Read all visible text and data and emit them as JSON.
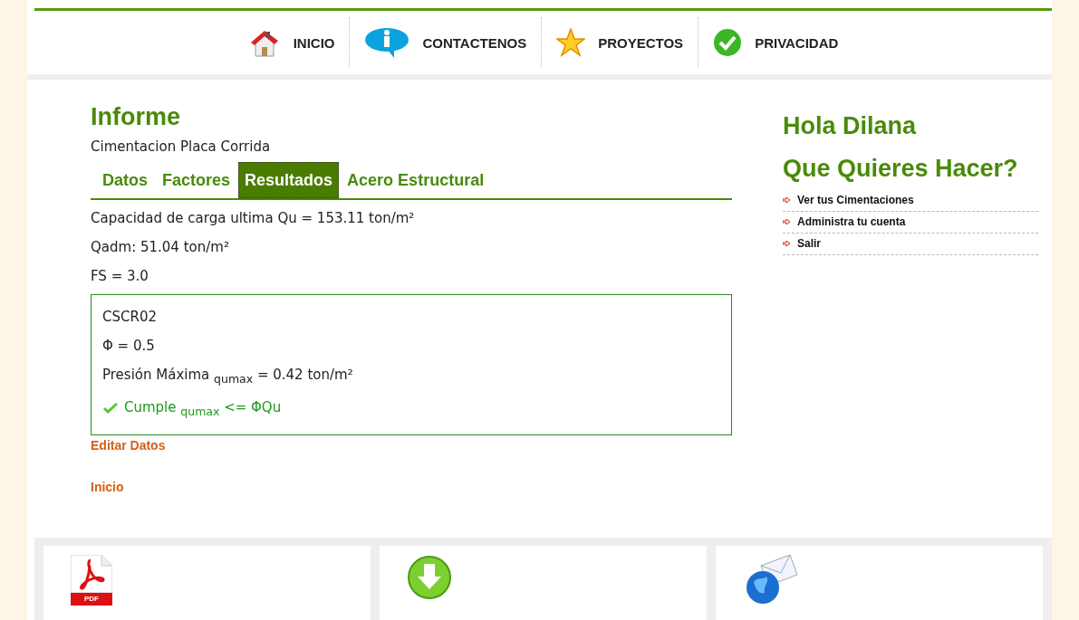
{
  "nav": [
    {
      "label": "INICIO",
      "kind": "house"
    },
    {
      "label": "CONTACTENOS",
      "kind": "info"
    },
    {
      "label": "PROYECTOS",
      "kind": "star"
    },
    {
      "label": "PRIVACIDAD",
      "kind": "check"
    }
  ],
  "report": {
    "title": "Informe",
    "subtitle": "Cimentacion Placa Corrida",
    "tabs": [
      {
        "label": "Datos",
        "selected": false
      },
      {
        "label": "Factores",
        "selected": false
      },
      {
        "label": "Resultados",
        "selected": true
      },
      {
        "label": "Acero Estructural",
        "selected": false
      }
    ],
    "results": [
      "Capacidad de carga ultima Qu = 153.11 ton/m²",
      "Qadm: 51.04 ton/m²",
      "FS = 3.0"
    ],
    "check_box": {
      "lines": [
        "CSCR02",
        "Φ = 0.5",
        "Presión Máxima $_{qumax}$ = 0.42 ton/m²"
      ],
      "verdict": {
        "text": "Cumple $_{qumax}$ <= ΦQu",
        "passed": true
      }
    },
    "links": [
      "Editar Datos",
      "Inicio"
    ]
  },
  "sidebar": {
    "greeting": "Hola Dilana",
    "heading": "Que Quieres Hacer?",
    "items": [
      "Ver tus Cimentaciones",
      "Administra tu cuenta",
      "Salir"
    ]
  },
  "footer": {
    "cards": [
      {
        "kind": "pdf",
        "icon_text": "PDF"
      },
      {
        "kind": "download"
      },
      {
        "kind": "mail"
      }
    ]
  }
}
